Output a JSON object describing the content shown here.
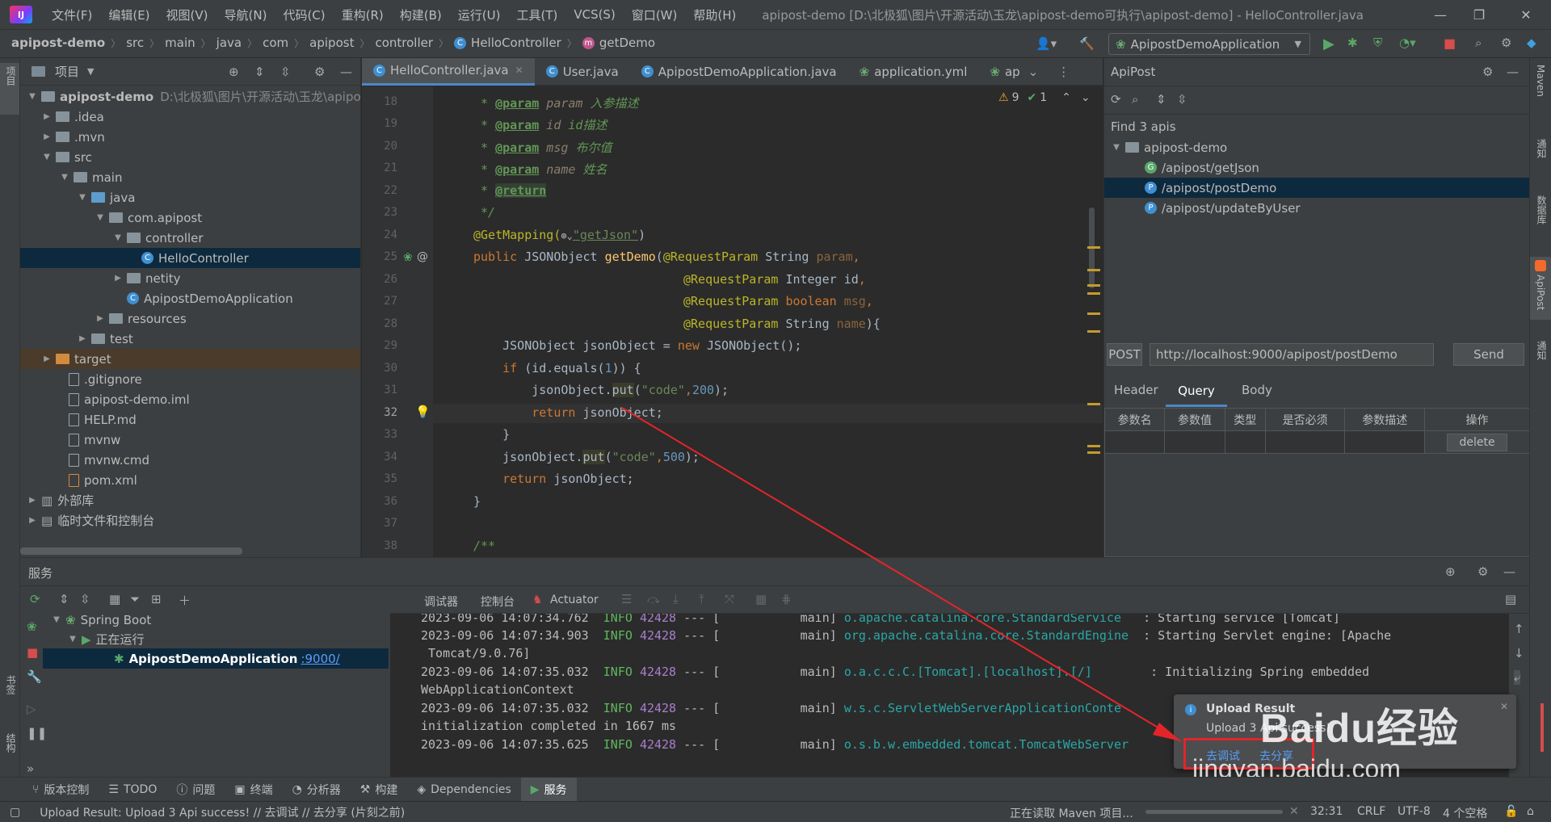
{
  "menu": [
    "文件(F)",
    "编辑(E)",
    "视图(V)",
    "导航(N)",
    "代码(C)",
    "重构(R)",
    "构建(B)",
    "运行(U)",
    "工具(T)",
    "VCS(S)",
    "窗口(W)",
    "帮助(H)"
  ],
  "window_title": "apipost-demo [D:\\北极狐\\图片\\开源活动\\玉龙\\apipost-demo可执行\\apipost-demo] - HelloController.java",
  "breadcrumb": [
    "apipost-demo",
    "src",
    "main",
    "java",
    "com",
    "apipost",
    "controller",
    "HelloController",
    "getDemo"
  ],
  "run_config": "ApipostDemoApplication",
  "project": {
    "title": "项目",
    "root": "apipost-demo",
    "root_path": "D:\\北极狐\\图片\\开源活动\\玉龙\\apipo",
    "items": [
      ".idea",
      ".mvn",
      "src",
      "main",
      "java",
      "com.apipost",
      "controller",
      "HelloController",
      "netity",
      "ApipostDemoApplication",
      "resources",
      "test",
      "target",
      ".gitignore",
      "apipost-demo.iml",
      "HELP.md",
      "mvnw",
      "mvnw.cmd",
      "pom.xml",
      "外部库",
      "临时文件和控制台"
    ]
  },
  "tabs": [
    "HelloController.java",
    "User.java",
    "ApipostDemoApplication.java",
    "application.yml",
    "ap"
  ],
  "inspections": {
    "warnings": "9",
    "ok": "1"
  },
  "line_numbers": [
    "18",
    "19",
    "20",
    "21",
    "22",
    "23",
    "24",
    "25",
    "26",
    "27",
    "28",
    "29",
    "30",
    "31",
    "32",
    "33",
    "34",
    "35",
    "36",
    "37",
    "38"
  ],
  "code": {
    "l18a": " * ",
    "l18b": "@param",
    "l18c": " param ",
    "l18d": "入参描述",
    "l19a": " * ",
    "l19b": "@param",
    "l19c": " id ",
    "l19d": "id描述",
    "l20a": " * ",
    "l20b": "@param",
    "l20c": " msg ",
    "l20d": "布尔值",
    "l21a": " * ",
    "l21b": "@param",
    "l21c": " name ",
    "l21d": "姓名",
    "l22a": " * ",
    "l22b": "@return",
    "l23": " */",
    "l24a": "@GetMapping(",
    "l24b": "\"getJson\"",
    "l24c": ")",
    "l25a": "public ",
    "l25b": "JSONObject ",
    "l25c": "getDemo",
    "l25d": "(",
    "l25e": "@RequestParam ",
    "l25f": "String ",
    "l25g": "param",
    ",": ",",
    "l26a": "@RequestParam ",
    "l26b": "Integer ",
    "l26c": "id",
    "l27a": "@RequestParam ",
    "l27b": "boolean ",
    "l27c": "msg",
    "l28a": "@RequestParam ",
    "l28b": "String ",
    "l28c": "name",
    "l28d": "){",
    "l29a": "    JSONObject jsonObject = ",
    "l29b": "new ",
    "l29c": "JSONObject();",
    "l30a": "    ",
    "l30b": "if ",
    "l30c": "(id.equals(",
    "l30d": "1",
    "l30e": ")) {",
    "l31a": "        jsonObject.",
    "l31b": "put",
    "l31c": "(",
    "l31d": "\"code\"",
    "l31e": ",",
    "l31f": "200",
    "l31g": ");",
    "l32a": "        ",
    "l32b": "return ",
    "l32c": "jsonObject;",
    "l33": "    }",
    "l34a": "    jsonObject.",
    "l34b": "put",
    "l34c": "(",
    "l34d": "\"code\"",
    "l34e": ",",
    "l34f": "500",
    "l34g": ");",
    "l35a": "    ",
    "l35b": "return ",
    "l35c": "jsonObject;",
    "l36": "}",
    "l38": "/**"
  },
  "apipost": {
    "title": "ApiPost",
    "found": "Find 3 apis",
    "project": "apipost-demo",
    "apis": [
      {
        "method": "G",
        "path": "/apipost/getJson"
      },
      {
        "method": "P",
        "path": "/apipost/postDemo"
      },
      {
        "method": "P",
        "path": "/apipost/updateByUser"
      }
    ],
    "method": "POST",
    "url": "http://localhost:9000/apipost/postDemo",
    "send": "Send",
    "subtabs": [
      "Header",
      "Query",
      "Body"
    ],
    "columns": [
      "参数名",
      "参数值",
      "类型",
      "是否必须",
      "参数描述",
      "操作"
    ],
    "delete": "delete"
  },
  "services": {
    "title": "服务",
    "spring_boot": "Spring Boot",
    "running": "正在运行",
    "app": "ApipostDemoApplication",
    "port": ":9000/",
    "console_tabs": [
      "调试器",
      "控制台",
      "Actuator"
    ]
  },
  "console": [
    {
      "ts": "2023-09-06 14:07:34.762",
      "lvl": "INFO",
      "pid": "42428",
      "sep": "--- [",
      "thread": "main]",
      "logger": "o.apache.catalina.core.StandardService",
      "msg": ": Starting service [Tomcat]"
    },
    {
      "ts": "2023-09-06 14:07:34.903",
      "lvl": "INFO",
      "pid": "42428",
      "sep": "--- [",
      "thread": "main]",
      "logger": "org.apache.catalina.core.StandardEngine",
      "msg": ": Starting Servlet engine: [Apache"
    },
    {
      "cont": " Tomcat/9.0.76]"
    },
    {
      "ts": "2023-09-06 14:07:35.032",
      "lvl": "INFO",
      "pid": "42428",
      "sep": "--- [",
      "thread": "main]",
      "logger": "o.a.c.c.C.[Tomcat].[localhost].[/]",
      "msg": ": Initializing Spring embedded"
    },
    {
      "cont": "WebApplicationContext"
    },
    {
      "ts": "2023-09-06 14:07:35.032",
      "lvl": "INFO",
      "pid": "42428",
      "sep": "--- [",
      "thread": "main]",
      "logger": "w.s.c.ServletWebServerApplicationConte",
      "msg": ""
    },
    {
      "cont": "initialization completed in 1667 ms"
    },
    {
      "ts": "2023-09-06 14:07:35.625",
      "lvl": "INFO",
      "pid": "42428",
      "sep": "--- [",
      "thread": "main]",
      "logger": "o.s.b.w.embedded.tomcat.TomcatWebServer",
      "msg": ""
    }
  ],
  "notification": {
    "title": "Upload Result",
    "body": "Upload 3 Api success!",
    "debug": "去调试",
    "share": "去分享"
  },
  "watermark": {
    "brand": "Baidu经验",
    "url": "jingyan.baidu.com"
  },
  "toolwindows": [
    "版本控制",
    "TODO",
    "问题",
    "终端",
    "分析器",
    "构建",
    "Dependencies",
    "服务"
  ],
  "status": {
    "message": "Upload Result: Upload 3 Api success! // 去调试 // 去分享 (片刻之前)",
    "task": "正在读取 Maven 项目...",
    "position": "32:31",
    "line_sep": "CRLF",
    "encoding": "UTF-8",
    "indent": "4 个空格"
  },
  "side_labels": {
    "left_top": "项目",
    "left_bm": "书签",
    "left_struct": "结构",
    "r1": "Maven",
    "r2": "通知",
    "r3": "数据库",
    "r4": "ApiPost",
    "r5": "通知"
  }
}
